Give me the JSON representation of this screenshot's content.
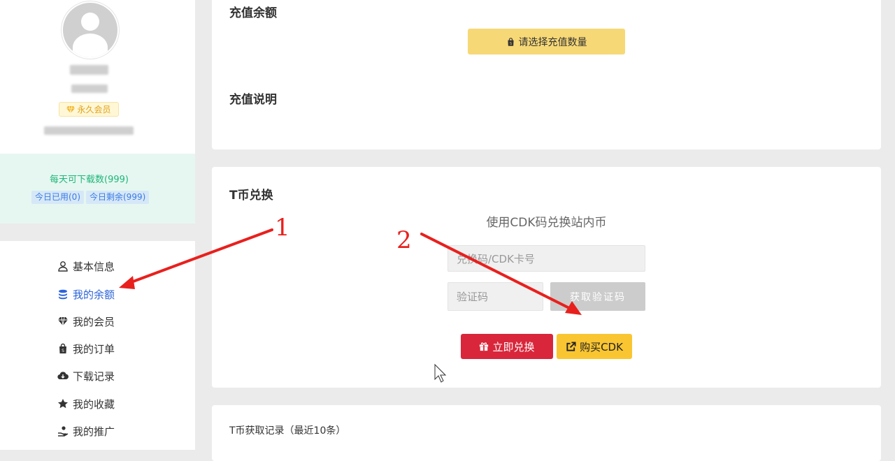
{
  "profile": {
    "vip_label": "永久会员"
  },
  "quota": {
    "title": "每天可下载数(999)",
    "used": "今日已用(0)",
    "remaining": "今日剩余(999)"
  },
  "menu": {
    "items": [
      {
        "label": "基本信息",
        "icon": "user-icon"
      },
      {
        "label": "我的余额",
        "icon": "coins-icon"
      },
      {
        "label": "我的会员",
        "icon": "diamond-icon"
      },
      {
        "label": "我的订单",
        "icon": "shopping-bag-icon"
      },
      {
        "label": "下载记录",
        "icon": "cloud-download-icon"
      },
      {
        "label": "我的收藏",
        "icon": "star-icon"
      },
      {
        "label": "我的推广",
        "icon": "hand-coin-icon"
      }
    ]
  },
  "recharge": {
    "amount_title": "充值余额",
    "select_button": "请选择充值数量",
    "notes_title": "充值说明"
  },
  "exchange": {
    "title": "T币兑换",
    "subtitle": "使用CDK码兑换站内币",
    "cdk_placeholder": "兑换码/CDK卡号",
    "code_placeholder": "验证码",
    "get_code_button": "获取验证码",
    "redeem_button": "立即兑换",
    "buy_button": "购买CDK"
  },
  "records": {
    "title": "T币获取记录（最近10条）"
  },
  "annotations": {
    "label_1": "1",
    "label_2": "2"
  },
  "colors": {
    "accent_blue": "#2c64d8",
    "quota_green": "#20b67a",
    "redeem_red": "#d9263a",
    "buy_yellow": "#f9c531",
    "select_yellow": "#f7d876",
    "annotation_red": "#e8201d"
  }
}
